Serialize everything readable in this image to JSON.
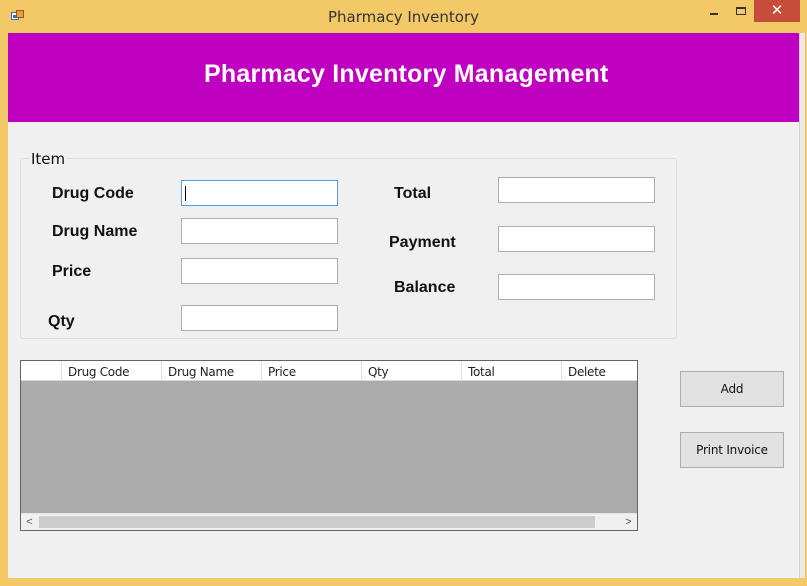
{
  "window": {
    "title": "Pharmacy Inventory",
    "close_glyph": "✕",
    "icons": {
      "app": "app-form-icon",
      "minimize": "minimize-icon",
      "maximize": "maximize-icon",
      "close": "close-icon"
    }
  },
  "header": {
    "title": "Pharmacy Inventory Management",
    "bg_color": "#c000c0"
  },
  "item_group": {
    "legend": "Item",
    "fields": {
      "drug_code": {
        "label": "Drug Code",
        "value": ""
      },
      "drug_name": {
        "label": "Drug Name",
        "value": ""
      },
      "price": {
        "label": "Price",
        "value": ""
      },
      "qty": {
        "label": "Qty",
        "value": ""
      },
      "total": {
        "label": "Total",
        "value": ""
      },
      "payment": {
        "label": "Payment",
        "value": ""
      },
      "balance": {
        "label": "Balance",
        "value": ""
      }
    }
  },
  "grid": {
    "columns": [
      "Drug Code",
      "Drug Name",
      "Price",
      "Qty",
      "Total",
      "Delete"
    ],
    "rows": [],
    "scroll_left_glyph": "<",
    "scroll_right_glyph": ">"
  },
  "buttons": {
    "add": "Add",
    "print_invoice": "Print Invoice"
  }
}
